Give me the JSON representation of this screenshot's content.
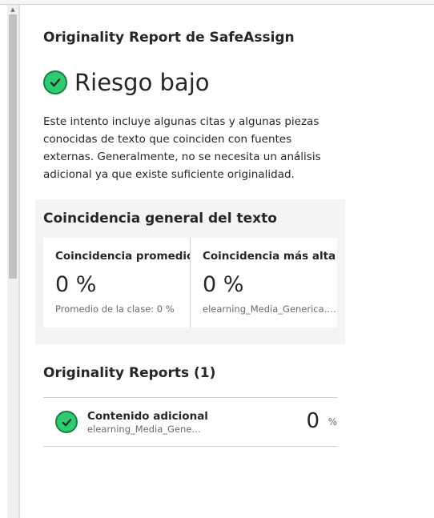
{
  "report": {
    "title": "Originality Report de SafeAssign",
    "risk_label": "Riesgo bajo",
    "risk_icon": "check-circle-icon",
    "risk_color": "#2ecc71",
    "description": "Este intento incluye algunas citas y algunas piezas conocidas de texto que coinciden con fuentes externas. Generalmente, no se necesita un análisis adicional ya que existe suficiente originalidad."
  },
  "overall_match": {
    "title": "Coincidencia general del texto",
    "average": {
      "label": "Coincidencia promedio",
      "value": "0 %",
      "sub": "Promedio de la clase: 0 %"
    },
    "highest": {
      "label": "Coincidencia más alta",
      "value": "0 %",
      "sub": "elearning_Media_Generica.p..."
    }
  },
  "reports": {
    "title": "Originality Reports (1)",
    "items": [
      {
        "name": "Contenido adicional",
        "file": "elearning_Media_Gener...",
        "score": "0",
        "unit": "%",
        "icon": "check-circle-icon"
      }
    ]
  },
  "scrollbar": {
    "up_arrow": "▲"
  }
}
